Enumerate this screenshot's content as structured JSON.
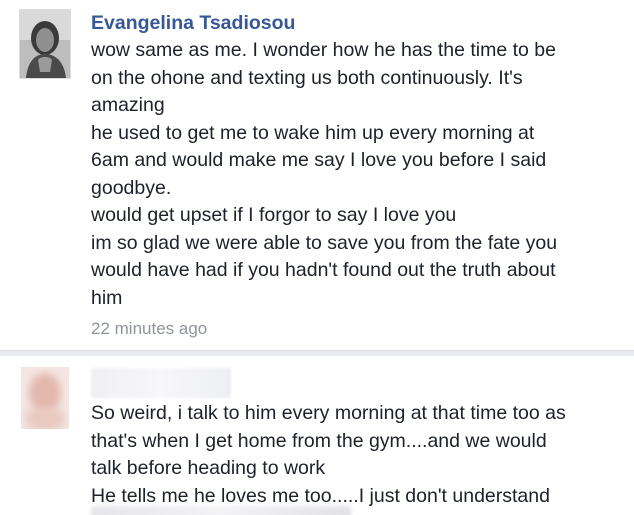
{
  "comments": [
    {
      "author": "Evangelina Tsadiosou",
      "lines": [
        "wow same as me. I wonder how he has the time to be",
        "on the ohone and texting us both continuously. It's",
        "amazing",
        "he used to get me to wake him up every morning at",
        "6am and would make me say I love you before I said",
        "goodbye.",
        "would get upset if I forgor to say I love you",
        "im so glad we were able to save you from the fate you",
        "would have had if you hadn't found out the truth about",
        "him"
      ],
      "timestamp": "22 minutes ago",
      "avatar_icon": "profile-photo"
    },
    {
      "author": "",
      "lines": [
        "So weird, i talk to him every morning at that time too as",
        "that's when I get home from the gym....and we would",
        "talk before heading to work",
        "He tells me he loves me too.....I just don't understand"
      ],
      "avatar_icon": "blurred-profile-photo"
    }
  ],
  "colors": {
    "author_link": "#365899",
    "body_text": "#1d2129",
    "timestamp": "#90949c",
    "divider": "#e9eaed"
  }
}
